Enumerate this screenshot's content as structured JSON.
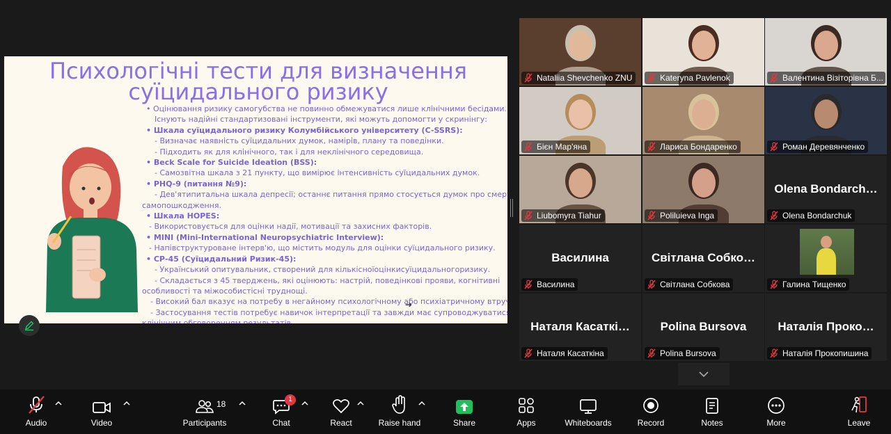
{
  "slide": {
    "title_line1": "Психологічні тести для визначення",
    "title_line2": "суїцидального ризику",
    "lines": [
      {
        "t": "•  Оцінювання ризику самогубства не повинно обмежуватися лише клінічними бесідами.",
        "b": false,
        "i": 10
      },
      {
        "t": "Існують надійні стандартизовані інструменти, які можуть допомогти у скринінгу:",
        "b": false,
        "i": 22
      },
      {
        "t": "•  Шкала суїцидального ризику Колумбійського університету (C-SSRS):",
        "b": true,
        "i": 10
      },
      {
        "t": "- Визначає наявність суїцидальних думок, намірів, плану та поведінки.",
        "b": false,
        "i": 22
      },
      {
        "t": "- Підходить як для клінічного, так і для неклінічного середовища.",
        "b": false,
        "i": 22
      },
      {
        "t": "•  Beck Scale for Suicide Ideation (BSS):",
        "b": true,
        "i": 10
      },
      {
        "t": "- Самозвітна шкала з 21 пункту, що вимірює інтенсивність суїцидальних думок.",
        "b": false,
        "i": 22
      },
      {
        "t": "•  PHQ-9 (питання №9):",
        "b": true,
        "i": 10
      },
      {
        "t": "- Дев'ятипитальна шкала депресії; останнє питання прямо стосується думок про смерть чи",
        "b": false,
        "i": 22
      },
      {
        "t": "самопошкодження.",
        "b": false,
        "i": 4
      },
      {
        "t": "•  Шкала HOPES:",
        "b": true,
        "i": 10
      },
      {
        "t": "- Використовується для оцінки надії, мотивації та захисних факторів.",
        "b": false,
        "i": 14
      },
      {
        "t": "•  MINI (Mini-International Neuropsychiatric Interview):",
        "b": true,
        "i": 10
      },
      {
        "t": "- Напівструктуроване інтерв'ю, що містить модуль для оцінки суїцидального ризику.",
        "b": false,
        "i": 14
      },
      {
        "t": "•  СР-45 (Суїцидальний Ризик-45):",
        "b": true,
        "i": 10
      },
      {
        "t": "- Український опитувальник, створений для кількісноїоцінкисуїцидальногоризику.",
        "b": false,
        "i": 22
      },
      {
        "t": "- Складається з 45 тверджень, які оцінюють: настрій, поведінкові прояви, когнітивні",
        "b": false,
        "i": 22
      },
      {
        "t": "особливості та міжособистісні труднощі.",
        "b": false,
        "i": 4
      },
      {
        "t": "- Високий бал вказує на потребу в негайному психологічному або психіатричному втручанні.",
        "b": false,
        "i": 16
      },
      {
        "t": "- Застосування тестів потребує навичок інтерпретації та завжди має супроводжуватися",
        "b": false,
        "i": 16
      },
      {
        "t": "клінічним обговоренням результатів.",
        "b": false,
        "i": 4
      }
    ]
  },
  "participants": [
    {
      "name": "Nataliia Shevchenko ZNU",
      "big": "",
      "video": true,
      "bg": "#5a3e2e",
      "skin": "#e0b89a",
      "hair": "#c9bfae",
      "active": false
    },
    {
      "name": "Kateryna Pavlenok",
      "big": "",
      "video": true,
      "bg": "#e8e2d8",
      "skin": "#e2b296",
      "hair": "#4a2c20",
      "active": false
    },
    {
      "name": "Валентина Візіторівна Б...",
      "big": "",
      "video": true,
      "bg": "#d9d6d1",
      "skin": "#d9a88e",
      "hair": "#3a2a22",
      "active": false
    },
    {
      "name": "Бієн Мар'яна",
      "big": "",
      "video": true,
      "bg": "#d2cbc3",
      "skin": "#e9c0a8",
      "hair": "#b48d5a",
      "active": true
    },
    {
      "name": "Лариса Бондаренко",
      "big": "",
      "video": true,
      "bg": "#a88a6e",
      "skin": "#dcae92",
      "hair": "#d8c29a",
      "active": false
    },
    {
      "name": "Роман Деревянченко",
      "big": "",
      "video": true,
      "bg": "#2a3346",
      "skin": "#b88a70",
      "hair": "#2a2a2a",
      "active": false
    },
    {
      "name": "Liubomyra Tiahur",
      "big": "",
      "video": true,
      "bg": "#b8a89a",
      "skin": "#d8a88c",
      "hair": "#4a3528",
      "active": false
    },
    {
      "name": "Poliluieva Inga",
      "big": "",
      "video": true,
      "bg": "#8e7a6a",
      "skin": "#d4a08a",
      "hair": "#3c2a22",
      "active": false
    },
    {
      "name": "Olena Bondarchuk",
      "big": "Olena  Bondarch…",
      "video": false,
      "active": false
    },
    {
      "name": "Василина",
      "big": "Василина",
      "video": false,
      "active": false
    },
    {
      "name": "Світлана Собкова",
      "big": "Світлана  Собко…",
      "video": false,
      "active": false
    },
    {
      "name": "Галина Тищенко",
      "big": "",
      "video": "photo",
      "active": false
    },
    {
      "name": "Наталя  Касаткіна",
      "big": "Наталя  Касаткі…",
      "video": false,
      "active": false
    },
    {
      "name": "Polina Bursova",
      "big": "Polina Bursova",
      "video": false,
      "active": false
    },
    {
      "name": "Наталія Прокопишина",
      "big": "Наталія  Проко…",
      "video": false,
      "active": false
    }
  ],
  "toolbar": {
    "audio": "Audio",
    "video": "Video",
    "participants": "Participants",
    "participants_count": "18",
    "chat": "Chat",
    "chat_badge": "1",
    "react": "React",
    "raise_hand": "Raise hand",
    "share": "Share",
    "apps": "Apps",
    "whiteboards": "Whiteboards",
    "record": "Record",
    "notes": "Notes",
    "more": "More",
    "leave": "Leave"
  },
  "colors": {
    "accent_green": "#22c36a",
    "share_green": "#1fbf5a",
    "mute_red": "#e0383e",
    "slide_purple": "#8b6fe6"
  }
}
